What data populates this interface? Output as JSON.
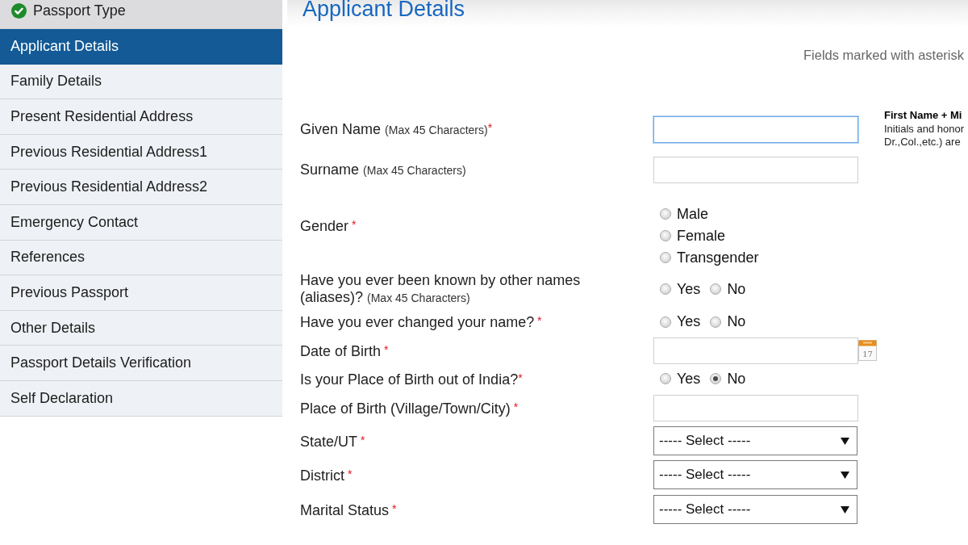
{
  "sidebar": {
    "items": [
      {
        "label": "Passport Type",
        "selected": false,
        "completed": true
      },
      {
        "label": "Applicant Details",
        "selected": true,
        "completed": false
      },
      {
        "label": "Family Details",
        "selected": false,
        "completed": false
      },
      {
        "label": "Present Residential Address",
        "selected": false,
        "completed": false
      },
      {
        "label": "Previous Residential Address1",
        "selected": false,
        "completed": false
      },
      {
        "label": "Previous Residential Address2",
        "selected": false,
        "completed": false
      },
      {
        "label": "Emergency Contact",
        "selected": false,
        "completed": false
      },
      {
        "label": "References",
        "selected": false,
        "completed": false
      },
      {
        "label": "Previous Passport",
        "selected": false,
        "completed": false
      },
      {
        "label": "Other Details",
        "selected": false,
        "completed": false
      },
      {
        "label": "Passport Details Verification",
        "selected": false,
        "completed": false
      },
      {
        "label": "Self Declaration",
        "selected": false,
        "completed": false
      }
    ]
  },
  "header": {
    "title": "Applicant Details",
    "note": "Fields marked with asterisk"
  },
  "side_note": [
    {
      "text": "First Name + Mi",
      "bold": true
    },
    {
      "text": "Initials and honor",
      "bold": false
    },
    {
      "text": "Dr.,Col.,etc.) are",
      "bold": false
    }
  ],
  "fields": [
    {
      "kind": "text",
      "label": "Given Name",
      "hint": "(Max 45 Characters)",
      "mark": "*",
      "focused": true
    },
    {
      "kind": "text",
      "label": "Surname",
      "hint": "(Max 45 Characters)",
      "focused": false
    },
    {
      "kind": "radio_stack",
      "label": "Gender",
      "mark": " *",
      "options": [
        {
          "label": "Male",
          "selected": false
        },
        {
          "label": "Female",
          "selected": false
        },
        {
          "label": "Transgender",
          "selected": false
        }
      ]
    },
    {
      "kind": "radio_row",
      "label": "Have you ever been known by other names (aliases)?",
      "hint": "(Max 45 Characters)",
      "options": [
        {
          "label": "Yes",
          "selected": false
        },
        {
          "label": "No",
          "selected": false
        }
      ]
    },
    {
      "kind": "radio_row",
      "label": "Have you ever changed your name?",
      "mark": " *",
      "options": [
        {
          "label": "Yes",
          "selected": false
        },
        {
          "label": "No",
          "selected": false
        }
      ]
    },
    {
      "kind": "date",
      "label": "Date of Birth",
      "mark": " *",
      "calendar_day": "17"
    },
    {
      "kind": "radio_row",
      "label": "Is your Place of Birth out of India?",
      "mark": "*",
      "options": [
        {
          "label": "Yes",
          "selected": false
        },
        {
          "label": "No",
          "selected": true
        }
      ]
    },
    {
      "kind": "text",
      "label": "Place of Birth (Village/Town/City)",
      "mark": " *",
      "focused": false
    },
    {
      "kind": "select",
      "label": "State/UT",
      "mark": " *",
      "value": "----- Select -----"
    },
    {
      "kind": "select",
      "label": "District",
      "mark": " *",
      "value": "----- Select -----"
    },
    {
      "kind": "select",
      "label": "Marital Status",
      "mark": " *",
      "value": "----- Select -----"
    }
  ]
}
